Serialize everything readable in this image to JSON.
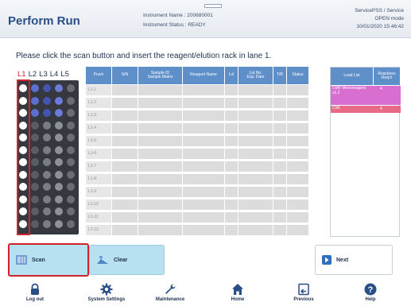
{
  "header": {
    "title": "Perform Run",
    "instrument_name": "Instrument Name : 200680001",
    "instrument_status": "Instrument Status : READY",
    "user": "ServicePSS / Service",
    "mode": "OPEN mode",
    "datetime": "10/01/2020 15:46:42"
  },
  "prompt": "Please click the scan button and insert the reagent/elution rack in lane 1.",
  "rack": {
    "lanes": [
      "L1",
      "L2",
      "L3",
      "L4",
      "L5"
    ]
  },
  "table": {
    "columns": [
      "Pos/n",
      "S/N",
      "Sample ID\nSample Matrix",
      "Reagent Name",
      "Lvl",
      "Lot No.\nExp. Date",
      "T/R",
      "Status"
    ],
    "rows": [
      "L1-1",
      "L1-2",
      "L1-3",
      "L1-4",
      "L1-5",
      "L1-6",
      "L1-7",
      "L1-8",
      "L1-9",
      "L1-10",
      "L1-11",
      "L1-12"
    ]
  },
  "load_list": {
    "columns": [
      "Load List",
      "Reactions Req'd"
    ],
    "items": [
      {
        "name": "CMV Monoreagent v1.2",
        "reactions": "4",
        "color": "#d86fd0"
      },
      {
        "name": "CML",
        "reactions": "4",
        "color": "#e86a86"
      }
    ]
  },
  "buttons": {
    "scan": "Scan",
    "clear": "Clear",
    "next": "Next"
  },
  "nav": {
    "logout": "Log out",
    "system_settings": "System Settings",
    "maintenance": "Maintenance",
    "home": "Home",
    "previous": "Previous",
    "help": "Help"
  },
  "colors": {
    "accent": "#5f8fc9",
    "button_bg": "#b7e0f0",
    "highlight": "#d2232a"
  }
}
